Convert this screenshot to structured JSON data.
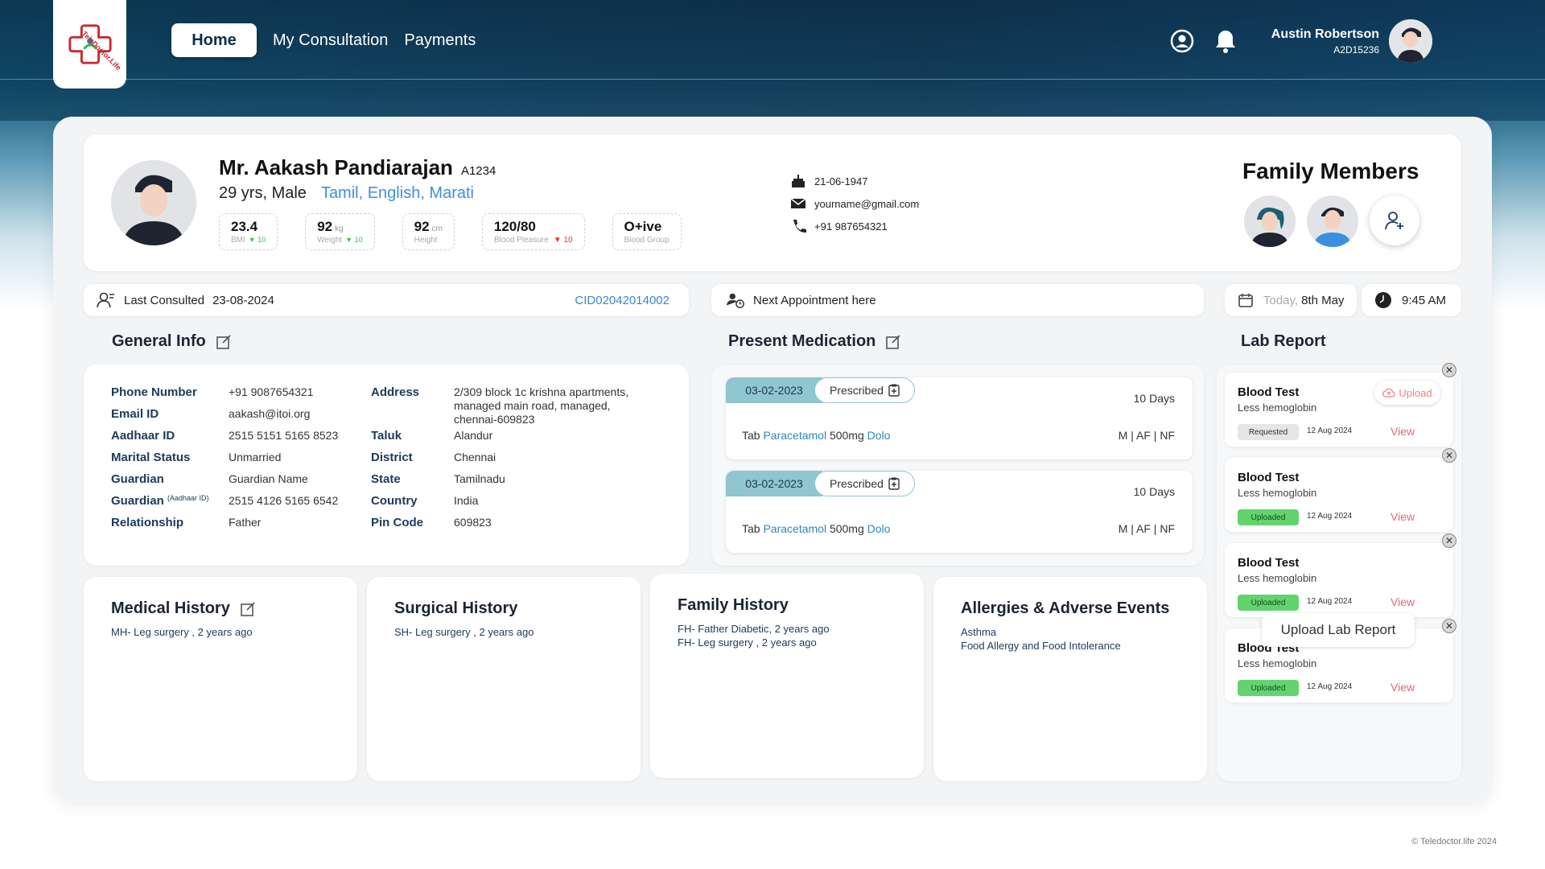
{
  "nav": {
    "logo_text": "TeleDoctor.Life",
    "home": "Home",
    "consultation": "My Consultation",
    "payments": "Payments",
    "icons": [
      "user-circle-icon",
      "bell-icon"
    ]
  },
  "user": {
    "name": "Austin Robertson",
    "id": "A2D15236"
  },
  "patient": {
    "name": "Mr. Aakash Pandiarajan",
    "code": "A1234",
    "age_gender": "29 yrs, Male",
    "languages": "Tamil, English, Marati",
    "stats": [
      {
        "value": "23.4",
        "unit": "",
        "label": "BMI",
        "trend": "10",
        "dir": "up"
      },
      {
        "value": "92",
        "unit": "kg",
        "label": "Weight",
        "trend": "10",
        "dir": "up"
      },
      {
        "value": "92",
        "unit": "cm",
        "label": "Height",
        "trend": "",
        "dir": ""
      },
      {
        "value": "120/80",
        "unit": "",
        "label": "Blood Pleasure",
        "trend": "10",
        "dir": "down"
      },
      {
        "value": "O+ive",
        "unit": "",
        "label": "Blood Group",
        "trend": "",
        "dir": ""
      }
    ],
    "dob": "21-06-1947",
    "email": "yourname@gmail.com",
    "phone": "+91 987654321"
  },
  "family": {
    "title": "Family Members"
  },
  "bar": {
    "last_consulted_label": "Last Consulted",
    "last_consulted_date": "23-08-2024",
    "cid": "CID02042014002",
    "next_appointment": "Next Appointment here",
    "today_label": "Today,",
    "today_date": "8th May",
    "time": "9:45 AM"
  },
  "general": {
    "title": "General Info",
    "left": [
      {
        "k": "Phone Number",
        "v": "+91 9087654321"
      },
      {
        "k": "Email ID",
        "v": "aakash@itoi.org"
      },
      {
        "k": "Aadhaar ID",
        "v": "2515 5151 5165 8523"
      },
      {
        "k": "Marital Status",
        "v": "Unmarried"
      },
      {
        "k": "Guardian",
        "v": "Guardian Name"
      },
      {
        "k": "Guardian",
        "k_small": "(Aadhaar ID)",
        "v": "2515 4126 5165 6542"
      },
      {
        "k": "Relationship",
        "v": "Father"
      }
    ],
    "address_label": "Address",
    "address_lines": [
      "2/309 block 1c krishna apartments,",
      "managed main road, managed,",
      "chennai-609823"
    ],
    "right": [
      {
        "k": "Taluk",
        "v": "Alandur"
      },
      {
        "k": "District",
        "v": "Chennai"
      },
      {
        "k": "State",
        "v": "Tamilnadu"
      },
      {
        "k": "Country",
        "v": "India"
      },
      {
        "k": "Pin Code",
        "v": "609823"
      }
    ]
  },
  "medication": {
    "title": "Present Medication",
    "items": [
      {
        "date": "03-02-2023",
        "status": "Prescribed",
        "days": "10 Days",
        "prefix": "Tab",
        "drug": "Paracetamol",
        "dose": "500mg",
        "brand": "Dolo",
        "schedule": "M | AF | NF"
      },
      {
        "date": "03-02-2023",
        "status": "Prescribed",
        "days": "10 Days",
        "prefix": "Tab",
        "drug": "Paracetamol",
        "dose": "500mg",
        "brand": "Dolo",
        "schedule": "M | AF | NF"
      }
    ]
  },
  "history": {
    "medical": {
      "title": "Medical History",
      "lines": [
        "MH- Leg surgery , 2 years ago"
      ]
    },
    "surgical": {
      "title": "Surgical History",
      "lines": [
        "SH- Leg surgery , 2 years ago"
      ]
    },
    "family": {
      "title": "Family History",
      "lines": [
        "FH- Father Diabetic, 2 years ago",
        "FH- Leg surgery , 2 years ago"
      ]
    },
    "allergies": {
      "title": "Allergies & Adverse Events",
      "lines": [
        "Asthma",
        "Food Allergy and Food Intolerance"
      ]
    }
  },
  "lab": {
    "title": "Lab Report",
    "items": [
      {
        "title": "Blood Test",
        "sub": "Less hemoglobin",
        "status": "Requested",
        "date": "12 Aug 2024",
        "view": "View",
        "upload": "Upload"
      },
      {
        "title": "Blood Test",
        "sub": "Less hemoglobin",
        "status": "Uploaded",
        "date": "12 Aug 2024",
        "view": "View",
        "upload": ""
      },
      {
        "title": "Blood Test",
        "sub": "Less hemoglobin",
        "status": "Uploaded",
        "date": "12 Aug 2024",
        "view": "View",
        "upload": ""
      },
      {
        "title": "Blood Test",
        "sub": "Less hemoglobin",
        "status": "Uploaded",
        "date": "12 Aug 2024",
        "view": "View",
        "upload": ""
      }
    ],
    "upload_button": "Upload Lab Report",
    "close_glyph": "✕"
  },
  "footer": {
    "copyright": "© Teledoctor.life 2024"
  },
  "colors": {
    "accent_blue": "#3e8fe0",
    "teal": "#8fc6cf",
    "header_dark": "#0d2f4a"
  }
}
